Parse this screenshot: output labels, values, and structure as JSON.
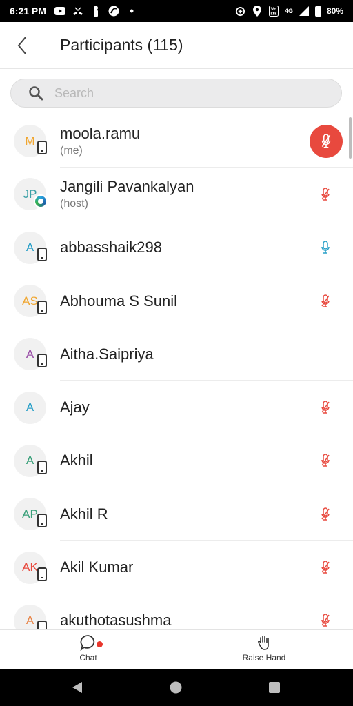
{
  "status_bar": {
    "time": "6:21 PM",
    "network": "4G",
    "battery": "80%",
    "icons": [
      "youtube-icon",
      "missed-call-icon",
      "person-icon",
      "app-icon",
      "dot-icon",
      "data-saver-icon",
      "location-icon",
      "volte-icon",
      "signal-icon",
      "battery-icon"
    ]
  },
  "header": {
    "title": "Participants (115)",
    "back_icon": "chevron-left-icon"
  },
  "search": {
    "placeholder": "Search",
    "value": ""
  },
  "participants": [
    {
      "initials": "M",
      "initials_color": "#f0a630",
      "name": "moola.ramu",
      "sub": "(me)",
      "device": "phone",
      "mic": "muted-highlight"
    },
    {
      "initials": "JP",
      "initials_color": "#3aa0a6",
      "name": "Jangili Pavankalyan",
      "sub": "(host)",
      "device": "zoom",
      "mic": "muted"
    },
    {
      "initials": "A",
      "initials_color": "#2aa0c8",
      "name": "abbasshaik298",
      "sub": "",
      "device": "phone",
      "mic": "on"
    },
    {
      "initials": "AS",
      "initials_color": "#f0a630",
      "name": "Abhouma S Sunil",
      "sub": "",
      "device": "phone",
      "mic": "muted"
    },
    {
      "initials": "A",
      "initials_color": "#9a4fa8",
      "name": "Aitha.Saipriya",
      "sub": "",
      "device": "phone",
      "mic": "none"
    },
    {
      "initials": "A",
      "initials_color": "#2aa0c8",
      "name": "Ajay",
      "sub": "",
      "device": "none",
      "mic": "muted"
    },
    {
      "initials": "A",
      "initials_color": "#3aa07a",
      "name": "Akhil",
      "sub": "",
      "device": "phone",
      "mic": "muted"
    },
    {
      "initials": "AP",
      "initials_color": "#3aa07a",
      "name": "Akhil R",
      "sub": "",
      "device": "phone",
      "mic": "muted"
    },
    {
      "initials": "AK",
      "initials_color": "#e8493e",
      "name": "Akil Kumar",
      "sub": "",
      "device": "phone",
      "mic": "muted"
    },
    {
      "initials": "A",
      "initials_color": "#e8864a",
      "name": "akuthotasushma",
      "sub": "",
      "device": "phone",
      "mic": "muted"
    }
  ],
  "toolbar": {
    "chat_label": "Chat",
    "raise_hand_label": "Raise Hand"
  },
  "colors": {
    "muted_mic": "#e8493e",
    "active_mic": "#2aa0c8",
    "notification_dot": "#e8362c"
  }
}
